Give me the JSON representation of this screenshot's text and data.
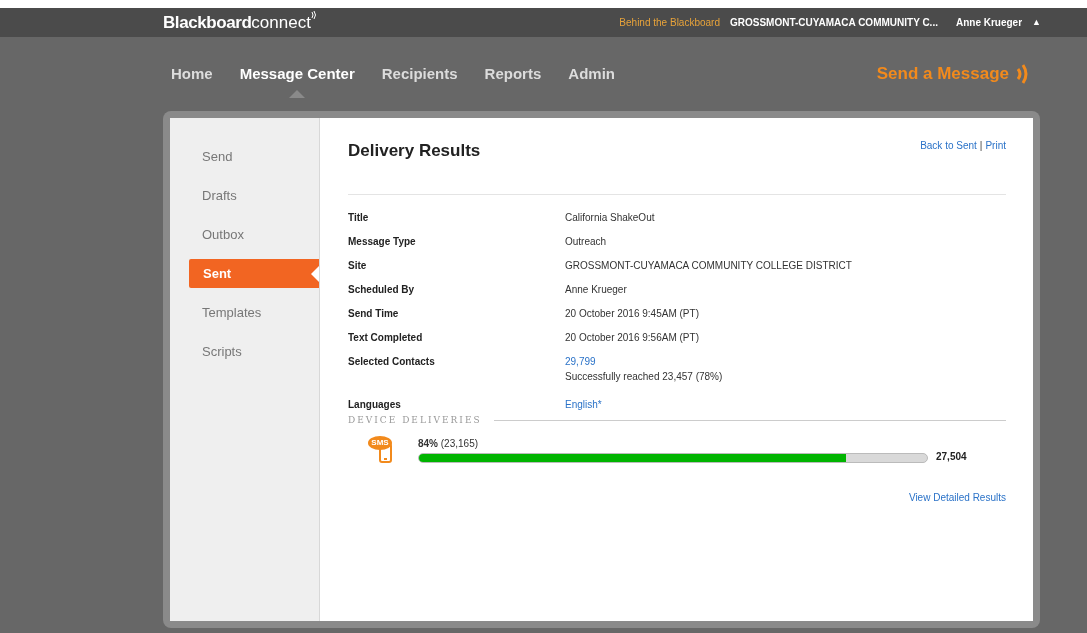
{
  "header": {
    "logo_bold": "Blackboard",
    "logo_light": "connect",
    "tagline": "Behind the Blackboard",
    "institution": "GROSSMONT-CUYAMACA COMMUNITY C...",
    "user": "Anne Krueger",
    "user_menu_caret": "▲"
  },
  "nav": {
    "items": [
      {
        "label": "Home",
        "selected": false
      },
      {
        "label": "Message Center",
        "selected": true
      },
      {
        "label": "Recipients",
        "selected": false
      },
      {
        "label": "Reports",
        "selected": false
      },
      {
        "label": "Admin",
        "selected": false
      }
    ],
    "send_button": "Send a Message"
  },
  "sidebar": {
    "items": [
      {
        "label": "Send",
        "selected": false
      },
      {
        "label": "Drafts",
        "selected": false
      },
      {
        "label": "Outbox",
        "selected": false
      },
      {
        "label": "Sent",
        "selected": true
      },
      {
        "label": "Templates",
        "selected": false
      },
      {
        "label": "Scripts",
        "selected": false
      }
    ]
  },
  "content": {
    "title": "Delivery Results",
    "links": [
      "Back to Sent",
      "Print"
    ],
    "link_separator": "|",
    "details": [
      {
        "label": "Title",
        "value": "California ShakeOut"
      },
      {
        "label": "Message Type",
        "value": "Outreach"
      },
      {
        "label": "Site",
        "value": "GROSSMONT-CUYAMACA COMMUNITY COLLEGE DISTRICT"
      },
      {
        "label": "Scheduled By",
        "value": "Anne Krueger"
      },
      {
        "label": "Send Time",
        "value": "20 October 2016 9:45AM (PT)"
      },
      {
        "label": "Text Completed",
        "value": "20 October 2016 9:56AM (PT)"
      },
      {
        "label": "Selected Contacts",
        "value": "29,799",
        "link": true,
        "note": "Successfully reached 23,457 (78%)"
      },
      {
        "label": "Languages",
        "value": "English*",
        "link": true
      }
    ],
    "section_title": "DEVICE DELIVERIES",
    "delivery": {
      "icon_label": "SMS",
      "reading": "**84%** (23,165)",
      "level": 0.84,
      "total": "27,504"
    },
    "detail_link": "View Detailed Results"
  }
}
